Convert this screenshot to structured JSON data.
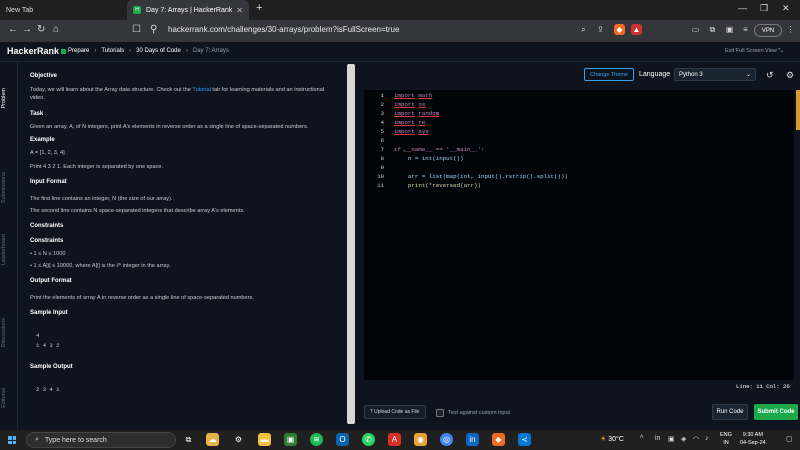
{
  "browser": {
    "tabs": [
      {
        "label": "New Tab",
        "active": false
      },
      {
        "label": "Day 7: Arrays | HackerRank",
        "active": true
      }
    ],
    "new_tab_icon": "+",
    "url": "hackerrank.com/challenges/30-arrays/problem?isFullScreen=true",
    "vpn_label": "VPN",
    "accent": "#1ba94c"
  },
  "header": {
    "logo": "HackerRank",
    "breadcrumbs": [
      "Prepare",
      "Tutorials",
      "30 Days of Code",
      "Day 7: Arrays"
    ],
    "exit_fullscreen": "Exit Full Screen View"
  },
  "left_rail": [
    "Problem",
    "Submissions",
    "Leaderboard",
    "Discussions",
    "Editorial"
  ],
  "problem": {
    "objective_h": "Objective",
    "objective_1": "Today, we will learn about the Array data structure. Check out the ",
    "objective_link": "Tutorial",
    "objective_2": " tab for learning materials and an instructional",
    "objective_3": "video.",
    "task_h": "Task",
    "task_text": "Given an array, A, of N integers, print A's elements in reverse order as a single line of space-separated numbers.",
    "example_h": "Example",
    "example_eq": "A = [1, 2, 3, 4]",
    "example_print": "Print 4 3 2 1. Each integer is separated by one space.",
    "input_h": "Input Format",
    "input_1": "The first line contains an integer, N (the size of our array).",
    "input_2": "The second line contains N space-separated integers that describe array A's elements.",
    "constraints_h1": "Constraints",
    "constraints_h2": "Constraints",
    "constraint_1": "1 ≤ N ≤ 1000",
    "constraint_2": "1 ≤ A[i] ≤ 10000, where A[i] is the iᵗʰ integer in the array.",
    "output_h": "Output Format",
    "output_text": "Print the elements of array A in reverse order as a single line of space-separated numbers.",
    "sample_input_h": "Sample Input",
    "sample_input_1": "4",
    "sample_input_2": "1 4 3 2",
    "sample_output_h": "Sample Output",
    "sample_output": "2 3 4 1"
  },
  "editor": {
    "change_theme": "Change Theme",
    "language_label": "Language",
    "language_value": "Python 3",
    "line_numbers": [
      "1",
      "2",
      "3",
      "4",
      "5",
      "6",
      "7",
      "8",
      "9",
      "10",
      "11"
    ],
    "status": "Line: 11 Col: 26",
    "upload": "Upload Code as File",
    "custom_input": "Test against custom input",
    "run": "Run Code",
    "submit": "Submit Code"
  },
  "code": {
    "l1_kw": "import",
    "l1_mod": "math",
    "l2_kw": "import",
    "l2_mod": "os",
    "l3_kw": "import",
    "l3_mod": "random",
    "l4_kw": "import",
    "l4_mod": "re",
    "l5_kw": "import",
    "l5_mod": "sys",
    "l7": "if __name__ == '__main__':",
    "l8": "    n = int(input())",
    "l10": "    arr = list(map(int, input().rstrip().split()))",
    "l11": "    print(*reversed(arr))"
  },
  "taskbar": {
    "search_placeholder": "Type here to search",
    "weather": "30°C",
    "lang_1": "ENG",
    "lang_2": "IN",
    "time": "9:30 AM",
    "date": "04-Sep-24"
  }
}
